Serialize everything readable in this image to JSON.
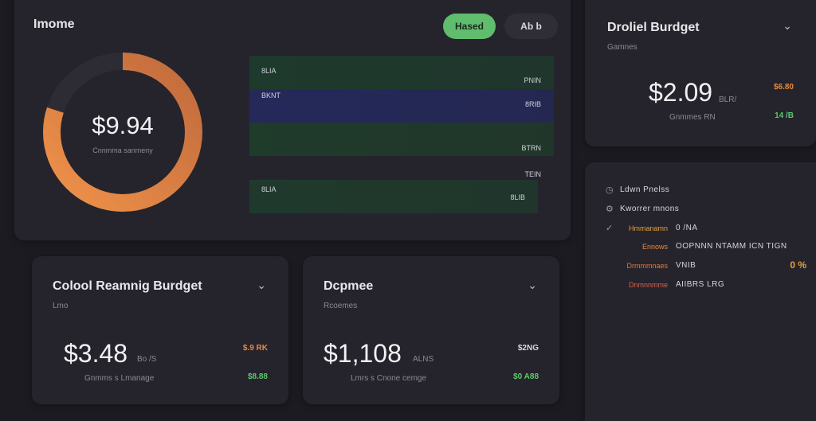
{
  "income": {
    "title": "Imome",
    "button_primary": "Hased",
    "button_secondary": "Ab b",
    "donut_value": "$9.94",
    "donut_caption": "Cnnmma sanmeny",
    "donut_fraction": 0.8,
    "colors": {
      "donut_start": "#f0924a",
      "donut_end": "#c06a3c",
      "donut_track": "#2d2c35"
    },
    "bands": [
      {
        "label": "8LIA",
        "right_top": "",
        "right_bottom": "PNIN",
        "color": "#1e3a2c"
      },
      {
        "label": "BKNT",
        "right_top": "",
        "right_bottom": "8RIB",
        "color": "#24295a"
      },
      {
        "label": "",
        "right_top": "",
        "right_bottom": "BTRN",
        "color": "#1f3b2a"
      },
      {
        "label": "8LIA",
        "right_top": "TEIN",
        "right_bottom": "8LIB",
        "color": "#1f3a2c"
      }
    ]
  },
  "overview": {
    "title": "Droliel Burdget",
    "subtitle": "Gamnes",
    "amount": "$2.09",
    "amount_suffix": "BLR/",
    "caption": "Gnmmes RN",
    "delta_top": "$6.80",
    "delta_bottom": "14 /B"
  },
  "list": {
    "items": [
      {
        "icon": "◷",
        "icon_name": "clock-icon",
        "key": "",
        "key_color": "#9d9ca6",
        "value": "Ldwn Pnelss"
      },
      {
        "icon": "⚙",
        "icon_name": "settings-icon",
        "key": "",
        "key_color": "#9d9ca6",
        "value": "Kworrer mnons"
      },
      {
        "icon": "✓",
        "icon_name": "check-icon",
        "key": "Hmmanamn",
        "key_color": "#e6a23c",
        "value": "0 /NA"
      },
      {
        "icon": "",
        "icon_name": "",
        "key": "Ennows",
        "key_color": "#e58a3c",
        "value": "OOPNNN NTAMM  ICN TIGN",
        "trailing": ""
      },
      {
        "icon": "",
        "icon_name": "",
        "key": "Drmmmnaes",
        "key_color": "#e07a3c",
        "value": "VNIB",
        "trailing": "0 %"
      },
      {
        "icon": "",
        "icon_name": "",
        "key": "Dnmnnmme",
        "key_color": "#d6624c",
        "value": "AIIBRS LRG"
      }
    ]
  },
  "crb": {
    "title": "Colool Reamnig Burdget",
    "subtitle": "Lmo",
    "amount": "$3.48",
    "amount_suffix": "Bo /S",
    "caption": "Gnmms s Lmanage",
    "delta_top": "$.9 RK",
    "delta_bottom": "$8.88"
  },
  "expense": {
    "title": "Dcpmee",
    "subtitle": "Rcoemes",
    "amount": "$1,108",
    "amount_suffix": "ALNS",
    "caption": "Lmrs s Cnone cemge",
    "delta_top": "$2NG",
    "delta_bottom": "$0 A88"
  }
}
